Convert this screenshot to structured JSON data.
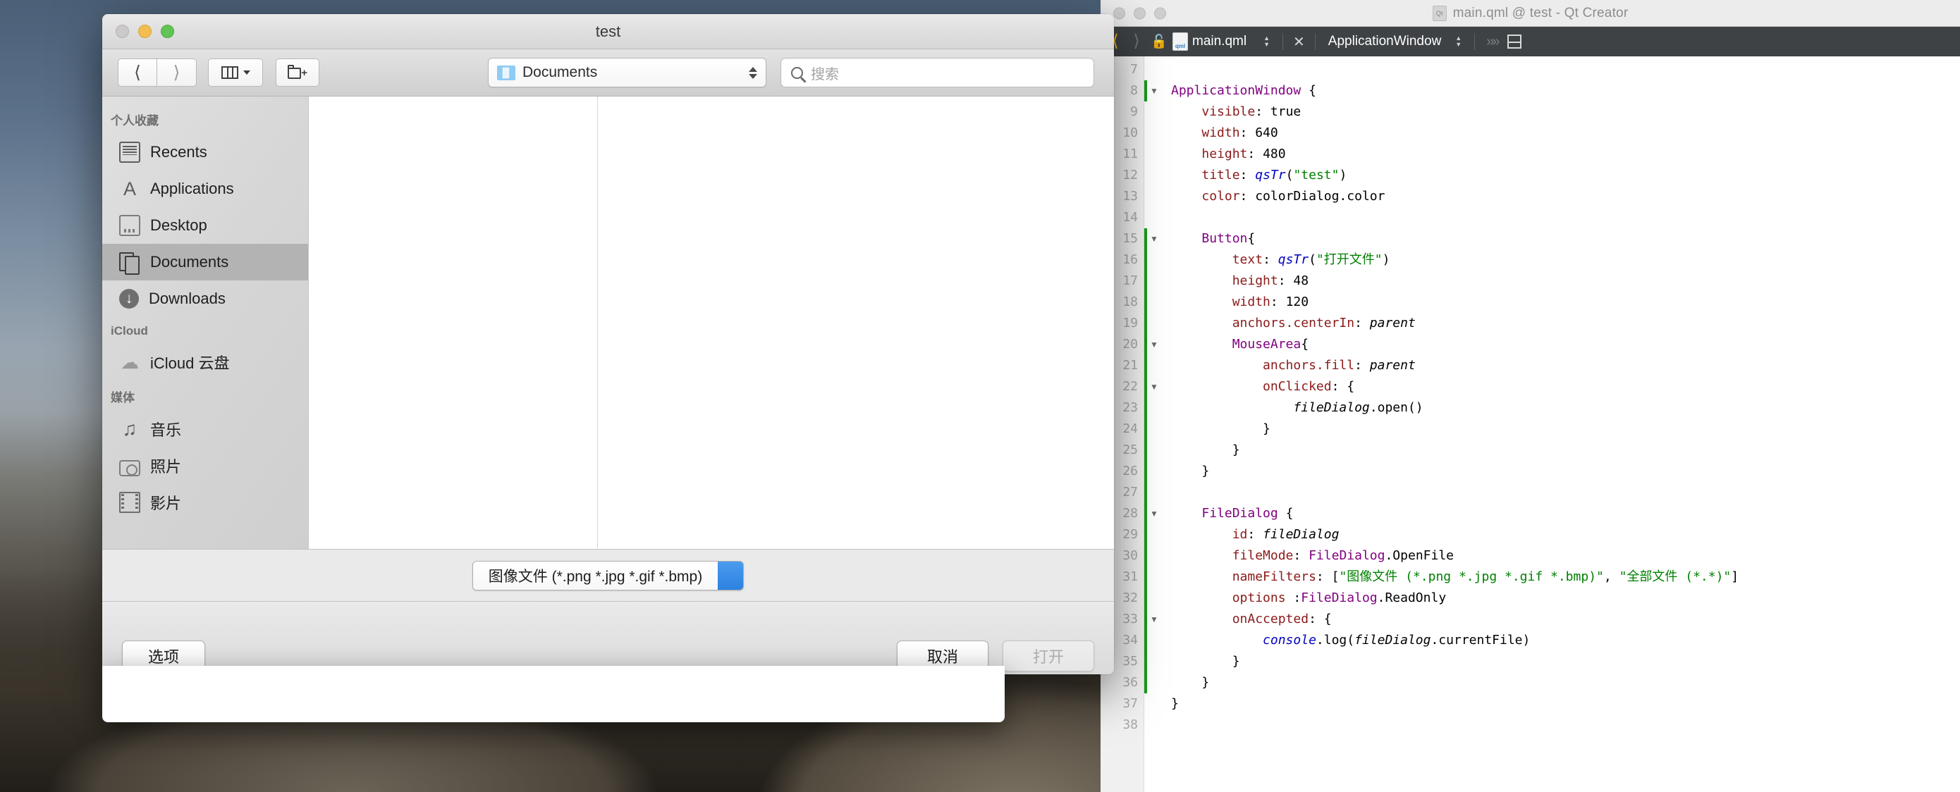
{
  "file_dialog": {
    "title": "test",
    "traffic_lights": [
      "close",
      "minimize",
      "maximize"
    ],
    "toolbar": {
      "back_label": "‹",
      "forward_label": "›",
      "view_mode": "column-view",
      "new_folder": "new-folder",
      "path_label": "Documents",
      "search_placeholder": "搜索"
    },
    "sidebar": {
      "sections": [
        {
          "header": "个人收藏",
          "items": [
            {
              "label": "Recents",
              "icon": "recents-icon",
              "selected": false
            },
            {
              "label": "Applications",
              "icon": "applications-icon",
              "selected": false
            },
            {
              "label": "Desktop",
              "icon": "desktop-icon",
              "selected": false
            },
            {
              "label": "Documents",
              "icon": "documents-icon",
              "selected": true
            },
            {
              "label": "Downloads",
              "icon": "downloads-icon",
              "selected": false
            }
          ]
        },
        {
          "header": "iCloud",
          "items": [
            {
              "label": "iCloud 云盘",
              "icon": "icloud-drive-icon",
              "selected": false
            }
          ]
        },
        {
          "header": "媒体",
          "items": [
            {
              "label": "音乐",
              "icon": "music-icon",
              "selected": false
            },
            {
              "label": "照片",
              "icon": "photos-icon",
              "selected": false
            },
            {
              "label": "影片",
              "icon": "movies-icon",
              "selected": false
            }
          ]
        }
      ]
    },
    "filter": {
      "selected": "图像文件 (*.png *.jpg *.gif *.bmp)",
      "options": [
        "图像文件 (*.png *.jpg *.gif *.bmp)",
        "全部文件 (*.*)"
      ]
    },
    "footer": {
      "options_label": "选项",
      "cancel_label": "取消",
      "open_label": "打开",
      "open_enabled": false
    }
  },
  "qt_creator": {
    "window_title": "main.qml @ test - Qt Creator",
    "window_icon": "qt-icon",
    "editbar": {
      "back_icon": "nav-back-icon",
      "forward_icon": "nav-forward-icon",
      "lock_icon": "unlocked-icon",
      "file_icon": "qml-file-icon",
      "filename": "main.qml",
      "close_label": "✕",
      "symbol": "ApplicationWindow",
      "more_icon": "chevrons-right-icon",
      "split_icon": "split-editor-icon"
    },
    "editor": {
      "first_line": 7,
      "last_line": 38,
      "fold_lines": [
        8,
        15,
        20,
        22,
        28,
        33
      ],
      "change_marked_lines": [
        8,
        15,
        16,
        17,
        18,
        19,
        20,
        21,
        22,
        23,
        24,
        25,
        26,
        27,
        28,
        29,
        30,
        31,
        32,
        33,
        34,
        35,
        36
      ],
      "lines": [
        {
          "n": 7,
          "tokens": []
        },
        {
          "n": 8,
          "tokens": [
            {
              "t": "type",
              "s": "ApplicationWindow"
            },
            {
              "t": "plain",
              "s": " {"
            }
          ]
        },
        {
          "n": 9,
          "tokens": [
            {
              "t": "plain",
              "s": "    "
            },
            {
              "t": "prop",
              "s": "visible"
            },
            {
              "t": "plain",
              "s": ": true"
            }
          ]
        },
        {
          "n": 10,
          "tokens": [
            {
              "t": "plain",
              "s": "    "
            },
            {
              "t": "prop",
              "s": "width"
            },
            {
              "t": "plain",
              "s": ": 640"
            }
          ]
        },
        {
          "n": 11,
          "tokens": [
            {
              "t": "plain",
              "s": "    "
            },
            {
              "t": "prop",
              "s": "height"
            },
            {
              "t": "plain",
              "s": ": 480"
            }
          ]
        },
        {
          "n": 12,
          "tokens": [
            {
              "t": "plain",
              "s": "    "
            },
            {
              "t": "prop",
              "s": "title"
            },
            {
              "t": "plain",
              "s": ": "
            },
            {
              "t": "fn",
              "s": "qsTr"
            },
            {
              "t": "plain",
              "s": "("
            },
            {
              "t": "str",
              "s": "\"test\""
            },
            {
              "t": "plain",
              "s": ")"
            }
          ]
        },
        {
          "n": 13,
          "tokens": [
            {
              "t": "plain",
              "s": "    "
            },
            {
              "t": "prop",
              "s": "color"
            },
            {
              "t": "plain",
              "s": ": colorDialog.color"
            }
          ]
        },
        {
          "n": 14,
          "tokens": []
        },
        {
          "n": 15,
          "tokens": [
            {
              "t": "plain",
              "s": "    "
            },
            {
              "t": "type",
              "s": "Button"
            },
            {
              "t": "plain",
              "s": "{"
            }
          ]
        },
        {
          "n": 16,
          "tokens": [
            {
              "t": "plain",
              "s": "        "
            },
            {
              "t": "prop",
              "s": "text"
            },
            {
              "t": "plain",
              "s": ": "
            },
            {
              "t": "fn",
              "s": "qsTr"
            },
            {
              "t": "plain",
              "s": "("
            },
            {
              "t": "str",
              "s": "\"打开文件\""
            },
            {
              "t": "plain",
              "s": ")"
            }
          ]
        },
        {
          "n": 17,
          "tokens": [
            {
              "t": "plain",
              "s": "        "
            },
            {
              "t": "prop",
              "s": "height"
            },
            {
              "t": "plain",
              "s": ": 48"
            }
          ]
        },
        {
          "n": 18,
          "tokens": [
            {
              "t": "plain",
              "s": "        "
            },
            {
              "t": "prop",
              "s": "width"
            },
            {
              "t": "plain",
              "s": ": 120"
            }
          ]
        },
        {
          "n": 19,
          "tokens": [
            {
              "t": "plain",
              "s": "        "
            },
            {
              "t": "prop",
              "s": "anchors.centerIn"
            },
            {
              "t": "plain",
              "s": ": "
            },
            {
              "t": "id",
              "s": "parent"
            }
          ]
        },
        {
          "n": 20,
          "tokens": [
            {
              "t": "plain",
              "s": "        "
            },
            {
              "t": "type",
              "s": "MouseArea"
            },
            {
              "t": "plain",
              "s": "{"
            }
          ]
        },
        {
          "n": 21,
          "tokens": [
            {
              "t": "plain",
              "s": "            "
            },
            {
              "t": "prop",
              "s": "anchors.fill"
            },
            {
              "t": "plain",
              "s": ": "
            },
            {
              "t": "id",
              "s": "parent"
            }
          ]
        },
        {
          "n": 22,
          "tokens": [
            {
              "t": "plain",
              "s": "            "
            },
            {
              "t": "prop",
              "s": "onClicked"
            },
            {
              "t": "plain",
              "s": ": {"
            }
          ]
        },
        {
          "n": 23,
          "tokens": [
            {
              "t": "plain",
              "s": "                "
            },
            {
              "t": "id",
              "s": "fileDialog"
            },
            {
              "t": "plain",
              "s": ".open()"
            }
          ]
        },
        {
          "n": 24,
          "tokens": [
            {
              "t": "plain",
              "s": "            }"
            }
          ]
        },
        {
          "n": 25,
          "tokens": [
            {
              "t": "plain",
              "s": "        }"
            }
          ]
        },
        {
          "n": 26,
          "tokens": [
            {
              "t": "plain",
              "s": "    }"
            }
          ]
        },
        {
          "n": 27,
          "tokens": []
        },
        {
          "n": 28,
          "tokens": [
            {
              "t": "plain",
              "s": "    "
            },
            {
              "t": "type",
              "s": "FileDialog"
            },
            {
              "t": "plain",
              "s": " {"
            }
          ]
        },
        {
          "n": 29,
          "tokens": [
            {
              "t": "plain",
              "s": "        "
            },
            {
              "t": "prop",
              "s": "id"
            },
            {
              "t": "plain",
              "s": ": "
            },
            {
              "t": "id",
              "s": "fileDialog"
            }
          ]
        },
        {
          "n": 30,
          "tokens": [
            {
              "t": "plain",
              "s": "        "
            },
            {
              "t": "prop",
              "s": "fileMode"
            },
            {
              "t": "plain",
              "s": ": "
            },
            {
              "t": "type",
              "s": "FileDialog"
            },
            {
              "t": "plain",
              "s": ".OpenFile"
            }
          ]
        },
        {
          "n": 31,
          "tokens": [
            {
              "t": "plain",
              "s": "        "
            },
            {
              "t": "prop",
              "s": "nameFilters"
            },
            {
              "t": "plain",
              "s": ": ["
            },
            {
              "t": "str",
              "s": "\"图像文件 (*.png *.jpg *.gif *.bmp)\""
            },
            {
              "t": "plain",
              "s": ", "
            },
            {
              "t": "str",
              "s": "\"全部文件 (*.*)\""
            },
            {
              "t": "plain",
              "s": "]"
            }
          ]
        },
        {
          "n": 32,
          "tokens": [
            {
              "t": "plain",
              "s": "        "
            },
            {
              "t": "prop",
              "s": "options"
            },
            {
              "t": "plain",
              "s": " :"
            },
            {
              "t": "type",
              "s": "FileDialog"
            },
            {
              "t": "plain",
              "s": ".ReadOnly"
            }
          ]
        },
        {
          "n": 33,
          "tokens": [
            {
              "t": "plain",
              "s": "        "
            },
            {
              "t": "prop",
              "s": "onAccepted"
            },
            {
              "t": "plain",
              "s": ": {"
            }
          ]
        },
        {
          "n": 34,
          "tokens": [
            {
              "t": "plain",
              "s": "            "
            },
            {
              "t": "fn",
              "s": "console"
            },
            {
              "t": "plain",
              "s": ".log("
            },
            {
              "t": "id",
              "s": "fileDialog"
            },
            {
              "t": "plain",
              "s": ".currentFile)"
            }
          ]
        },
        {
          "n": 35,
          "tokens": [
            {
              "t": "plain",
              "s": "        }"
            }
          ]
        },
        {
          "n": 36,
          "tokens": [
            {
              "t": "plain",
              "s": "    }"
            }
          ]
        },
        {
          "n": 37,
          "tokens": [
            {
              "t": "plain",
              "s": "}"
            }
          ]
        },
        {
          "n": 38,
          "tokens": []
        }
      ]
    }
  },
  "colors": {
    "editbar_bg": "#3e4245",
    "keyword_type": "#800080",
    "property": "#8b1a1a",
    "string": "#008000",
    "function": "#0000c0",
    "stepper_blue": "#2d82e0",
    "selection_gray": "#b3b3b3"
  }
}
